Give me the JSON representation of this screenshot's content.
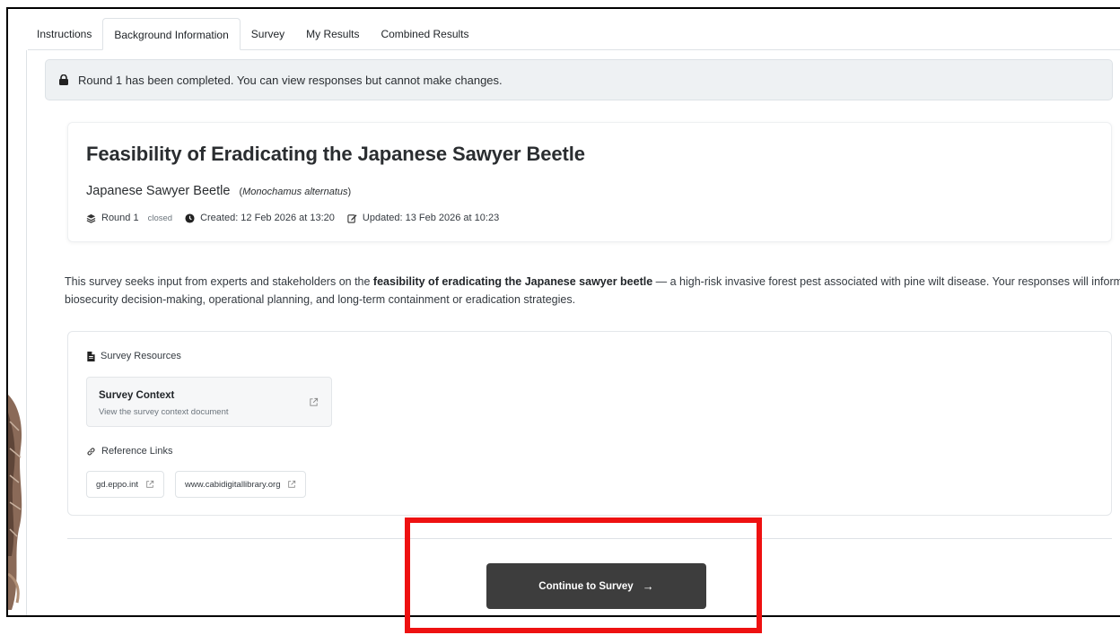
{
  "tabs": [
    {
      "label": "Instructions"
    },
    {
      "label": "Background Information"
    },
    {
      "label": "Survey"
    },
    {
      "label": "My Results"
    },
    {
      "label": "Combined Results"
    }
  ],
  "active_tab": "Background Information",
  "alert": {
    "icon": "lock-icon",
    "text": "Round 1 has been completed. You can view responses but cannot make changes."
  },
  "survey": {
    "title": "Feasibility of Eradicating the Japanese Sawyer Beetle",
    "species_common": "Japanese Sawyer Beetle",
    "species_scientific": "Monochamus alternatus",
    "round": "Round 1",
    "status": "closed",
    "created": "Created: 12 Feb 2026 at 13:20",
    "updated": "Updated: 13 Feb 2026 at 10:23"
  },
  "description": {
    "before": "This survey seeks input from experts and stakeholders on the ",
    "bold": "feasibility of eradicating the Japanese sawyer beetle",
    "after": " — a high-risk invasive forest pest associated with pine wilt disease. Your responses will inform biosecurity decision-making, operational planning, and long-term containment or eradication strategies."
  },
  "resources": {
    "heading": "Survey Resources",
    "document": {
      "title": "Survey Context",
      "subtitle": "View the survey context document"
    },
    "links_heading": "Reference Links",
    "links": [
      {
        "label": "gd.eppo.int"
      },
      {
        "label": "www.cabidigitallibrary.org"
      }
    ]
  },
  "continue_button": {
    "label": "Continue to Survey",
    "arrow": "→"
  },
  "colors": {
    "highlight": "#ee1111",
    "button_bg": "#3d3d3d",
    "alert_bg": "#eef1f3"
  }
}
